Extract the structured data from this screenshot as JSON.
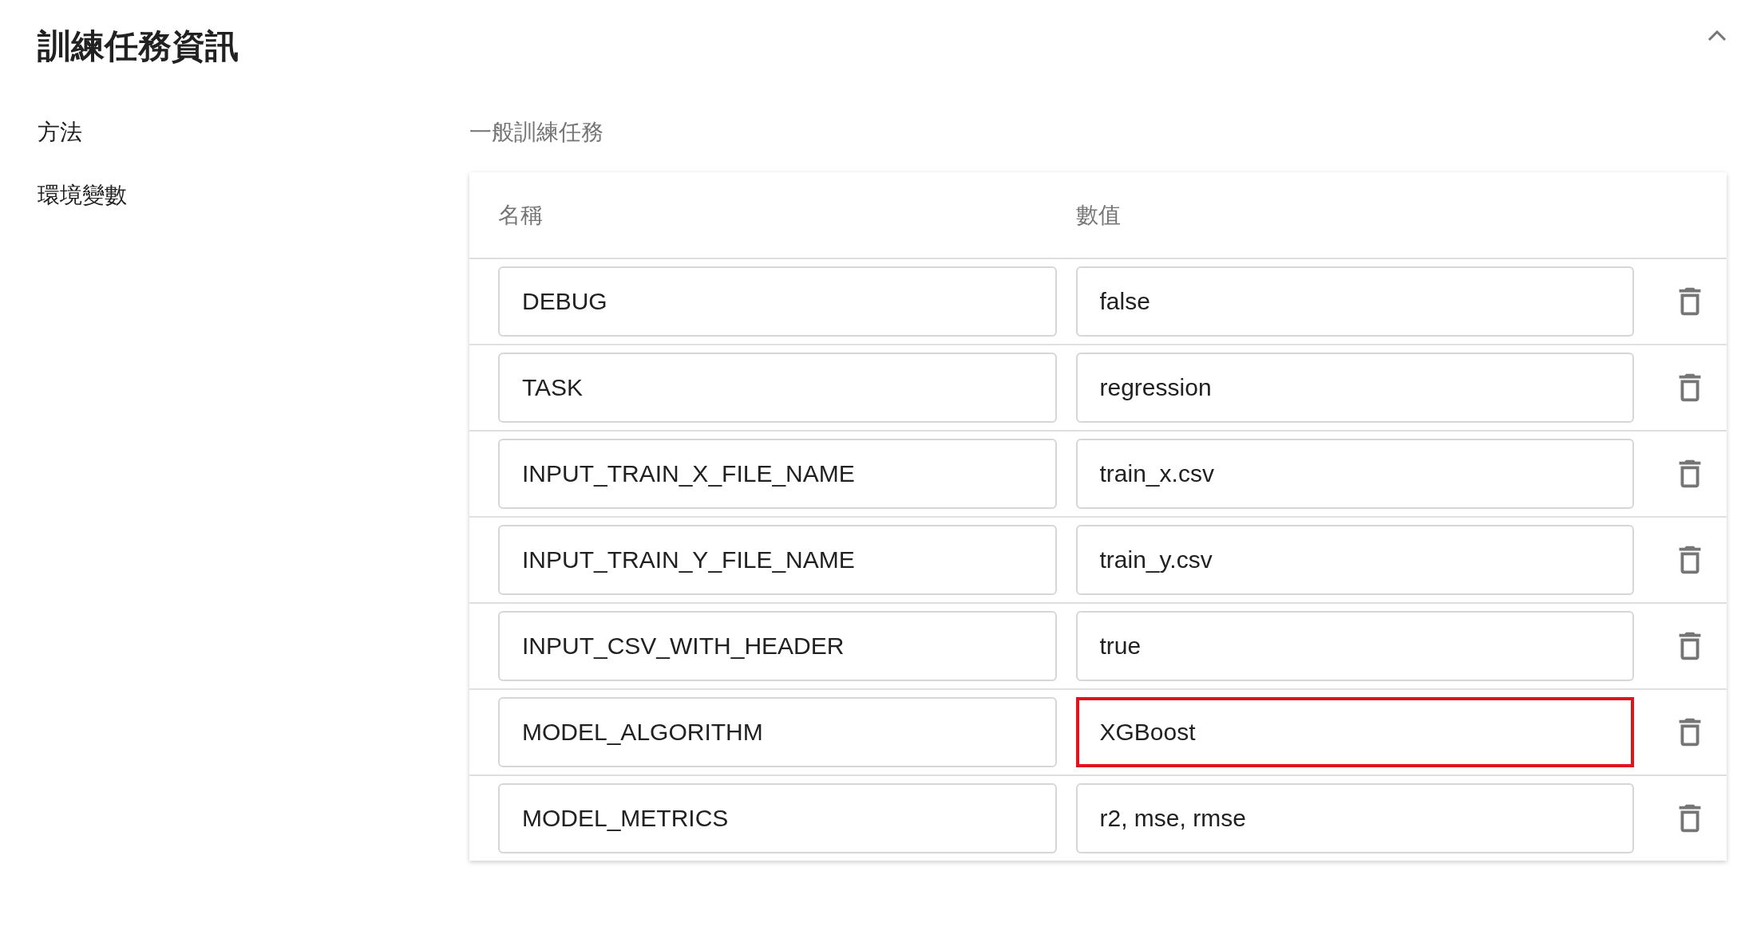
{
  "section": {
    "title": "訓練任務資訊",
    "expanded": true
  },
  "fields": [
    {
      "label": "方法",
      "value": "一般訓練任務"
    }
  ],
  "env": {
    "label": "環境變數",
    "columns": [
      "名稱",
      "數值"
    ],
    "rows": [
      {
        "name": "DEBUG",
        "value": "false",
        "highlighted": false
      },
      {
        "name": "TASK",
        "value": "regression",
        "highlighted": false
      },
      {
        "name": "INPUT_TRAIN_X_FILE_NAME",
        "value": "train_x.csv",
        "highlighted": false
      },
      {
        "name": "INPUT_TRAIN_Y_FILE_NAME",
        "value": "train_y.csv",
        "highlighted": false
      },
      {
        "name": "INPUT_CSV_WITH_HEADER",
        "value": "true",
        "highlighted": false
      },
      {
        "name": "MODEL_ALGORITHM",
        "value": "XGBoost",
        "highlighted": true
      },
      {
        "name": "MODEL_METRICS",
        "value": "r2, mse, rmse",
        "highlighted": false
      }
    ]
  }
}
